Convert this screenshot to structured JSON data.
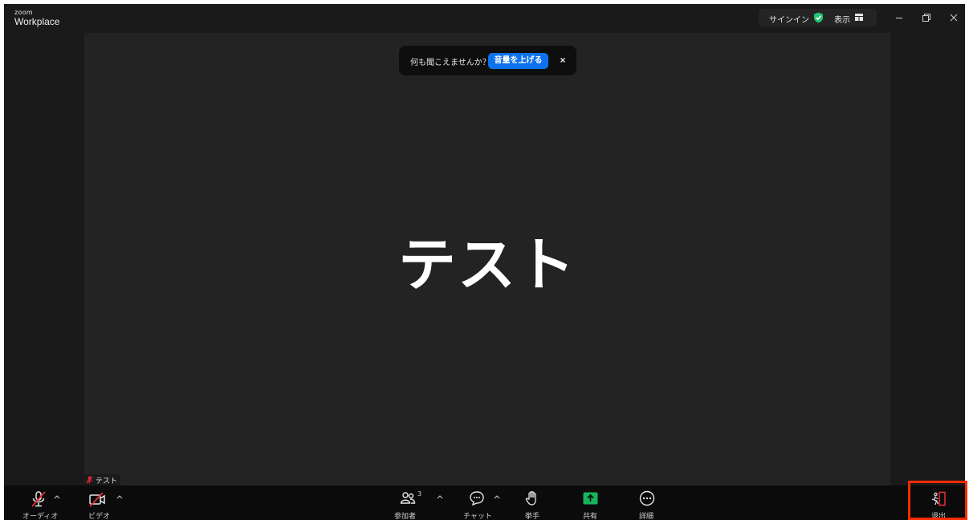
{
  "titlebar": {
    "logo_small": "zoom",
    "logo_big": "Workplace",
    "signin": "サインイン",
    "view": "表示"
  },
  "toast": {
    "message": "何も聞こえませんか？",
    "button": "音量を上げる"
  },
  "stage": {
    "participant_name": "テスト",
    "tile_label": "テスト"
  },
  "toolbar": {
    "audio": "オーディオ",
    "video": "ビデオ",
    "participants": "参加者",
    "participants_count": "3",
    "chat": "チャット",
    "raise_hand": "挙手",
    "share": "共有",
    "more": "詳細",
    "leave": "退出"
  },
  "colors": {
    "accent": "#0e72ed",
    "share_green": "#19b35c",
    "shield_green": "#23c36e",
    "muted_red": "#e5293a",
    "highlight": "#ff2a00"
  }
}
